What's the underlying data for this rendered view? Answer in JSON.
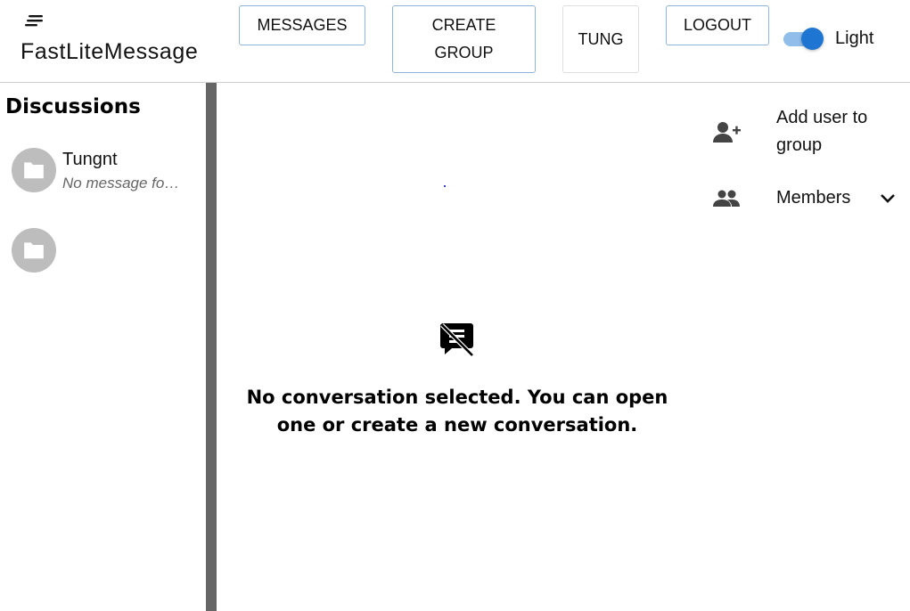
{
  "header": {
    "brand": "FastLiteMessage",
    "menu_icon": "menu-icon",
    "buttons": {
      "messages": "MESSAGES",
      "create_group_line1": "CREATE",
      "create_group_line2": "GROUP",
      "user": "TUNG",
      "logout": "LOGOUT"
    },
    "theme_toggle": {
      "label": "Light",
      "on": true,
      "accent": "#1f76d2"
    }
  },
  "sidebar": {
    "title": "Discussions",
    "items": [
      {
        "name": "Tungnt",
        "preview": "No message fo…",
        "icon": "folder-icon"
      },
      {
        "name": "",
        "preview": "",
        "icon": "folder-icon"
      }
    ]
  },
  "main": {
    "empty_icon": "speaker-notes-off-icon",
    "empty_line1": "No conversation selected. You can open",
    "empty_line2": "one or create a new conversation."
  },
  "right_panel": {
    "add_user_line1": "Add user to",
    "add_user_line2": "group",
    "add_user_icon": "person-add-icon",
    "members_label": "Members",
    "members_icon": "group-icon",
    "members_chevron": "chevron-down-icon"
  },
  "colors": {
    "divider": "#666666",
    "button_border": "#8fb4d6",
    "avatar_bg": "#bdbdbd"
  }
}
